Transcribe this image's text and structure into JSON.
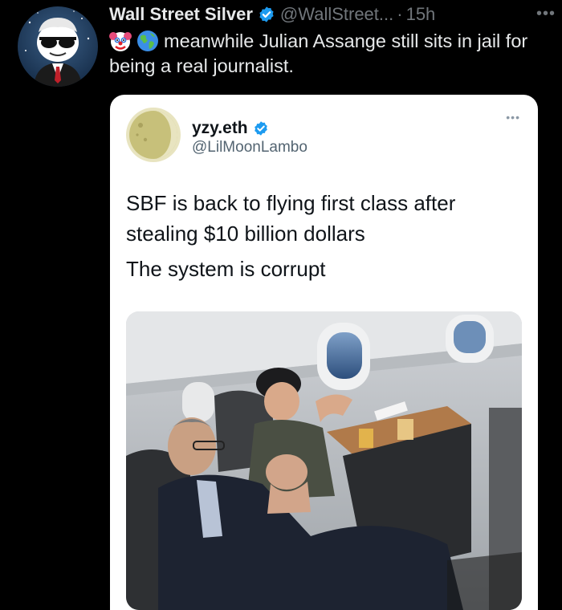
{
  "tweet": {
    "author_name": "Wall Street Silver",
    "author_handle": "@WallStreet...",
    "separator": "·",
    "time": "15h",
    "more_icon": "more-icon",
    "text": "meanwhile Julian Assange still sits in jail for being a real journalist.",
    "emojis": [
      "clown-face-emoji",
      "globe-emoji"
    ]
  },
  "quoted": {
    "author_name": "yzy.eth",
    "author_handle": "@LilMoonLambo",
    "text_line1": "SBF is back to flying first class after stealing $10 billion dollars",
    "text_line2": "The system is corrupt"
  },
  "colors": {
    "verified": "#1d9bf0",
    "background": "#000000",
    "card": "#ffffff"
  }
}
